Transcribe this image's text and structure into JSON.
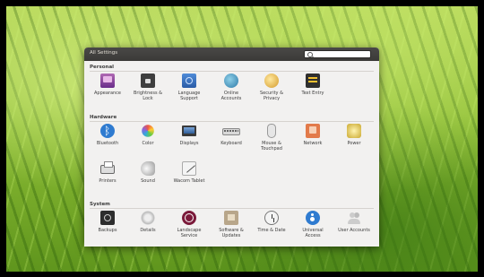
{
  "window": {
    "title": "All Settings"
  },
  "search": {
    "placeholder": ""
  },
  "sections": {
    "personal": {
      "title": "Personal",
      "items": [
        {
          "label": "Appearance",
          "icon": "appearance-icon"
        },
        {
          "label": "Brightness &\nLock",
          "icon": "brightness-lock-icon"
        },
        {
          "label": "Language\nSupport",
          "icon": "language-support-icon"
        },
        {
          "label": "Online\nAccounts",
          "icon": "online-accounts-icon"
        },
        {
          "label": "Security &\nPrivacy",
          "icon": "security-privacy-icon"
        },
        {
          "label": "Text Entry",
          "icon": "text-entry-icon"
        }
      ]
    },
    "hardware": {
      "title": "Hardware",
      "items": [
        {
          "label": "Bluetooth",
          "icon": "bluetooth-icon"
        },
        {
          "label": "Color",
          "icon": "color-icon"
        },
        {
          "label": "Displays",
          "icon": "displays-icon"
        },
        {
          "label": "Keyboard",
          "icon": "keyboard-icon"
        },
        {
          "label": "Mouse &\nTouchpad",
          "icon": "mouse-touchpad-icon"
        },
        {
          "label": "Network",
          "icon": "network-icon"
        },
        {
          "label": "Power",
          "icon": "power-icon"
        },
        {
          "label": "Printers",
          "icon": "printers-icon"
        },
        {
          "label": "Sound",
          "icon": "sound-icon"
        },
        {
          "label": "Wacom Tablet",
          "icon": "wacom-tablet-icon"
        }
      ]
    },
    "system": {
      "title": "System",
      "items": [
        {
          "label": "Backups",
          "icon": "backups-icon"
        },
        {
          "label": "Details",
          "icon": "details-icon"
        },
        {
          "label": "Landscape\nService",
          "icon": "landscape-service-icon"
        },
        {
          "label": "Software &\nUpdates",
          "icon": "software-updates-icon"
        },
        {
          "label": "Time & Date",
          "icon": "time-date-icon"
        },
        {
          "label": "Universal\nAccess",
          "icon": "universal-access-icon"
        },
        {
          "label": "User Accounts",
          "icon": "user-accounts-icon"
        }
      ]
    }
  }
}
